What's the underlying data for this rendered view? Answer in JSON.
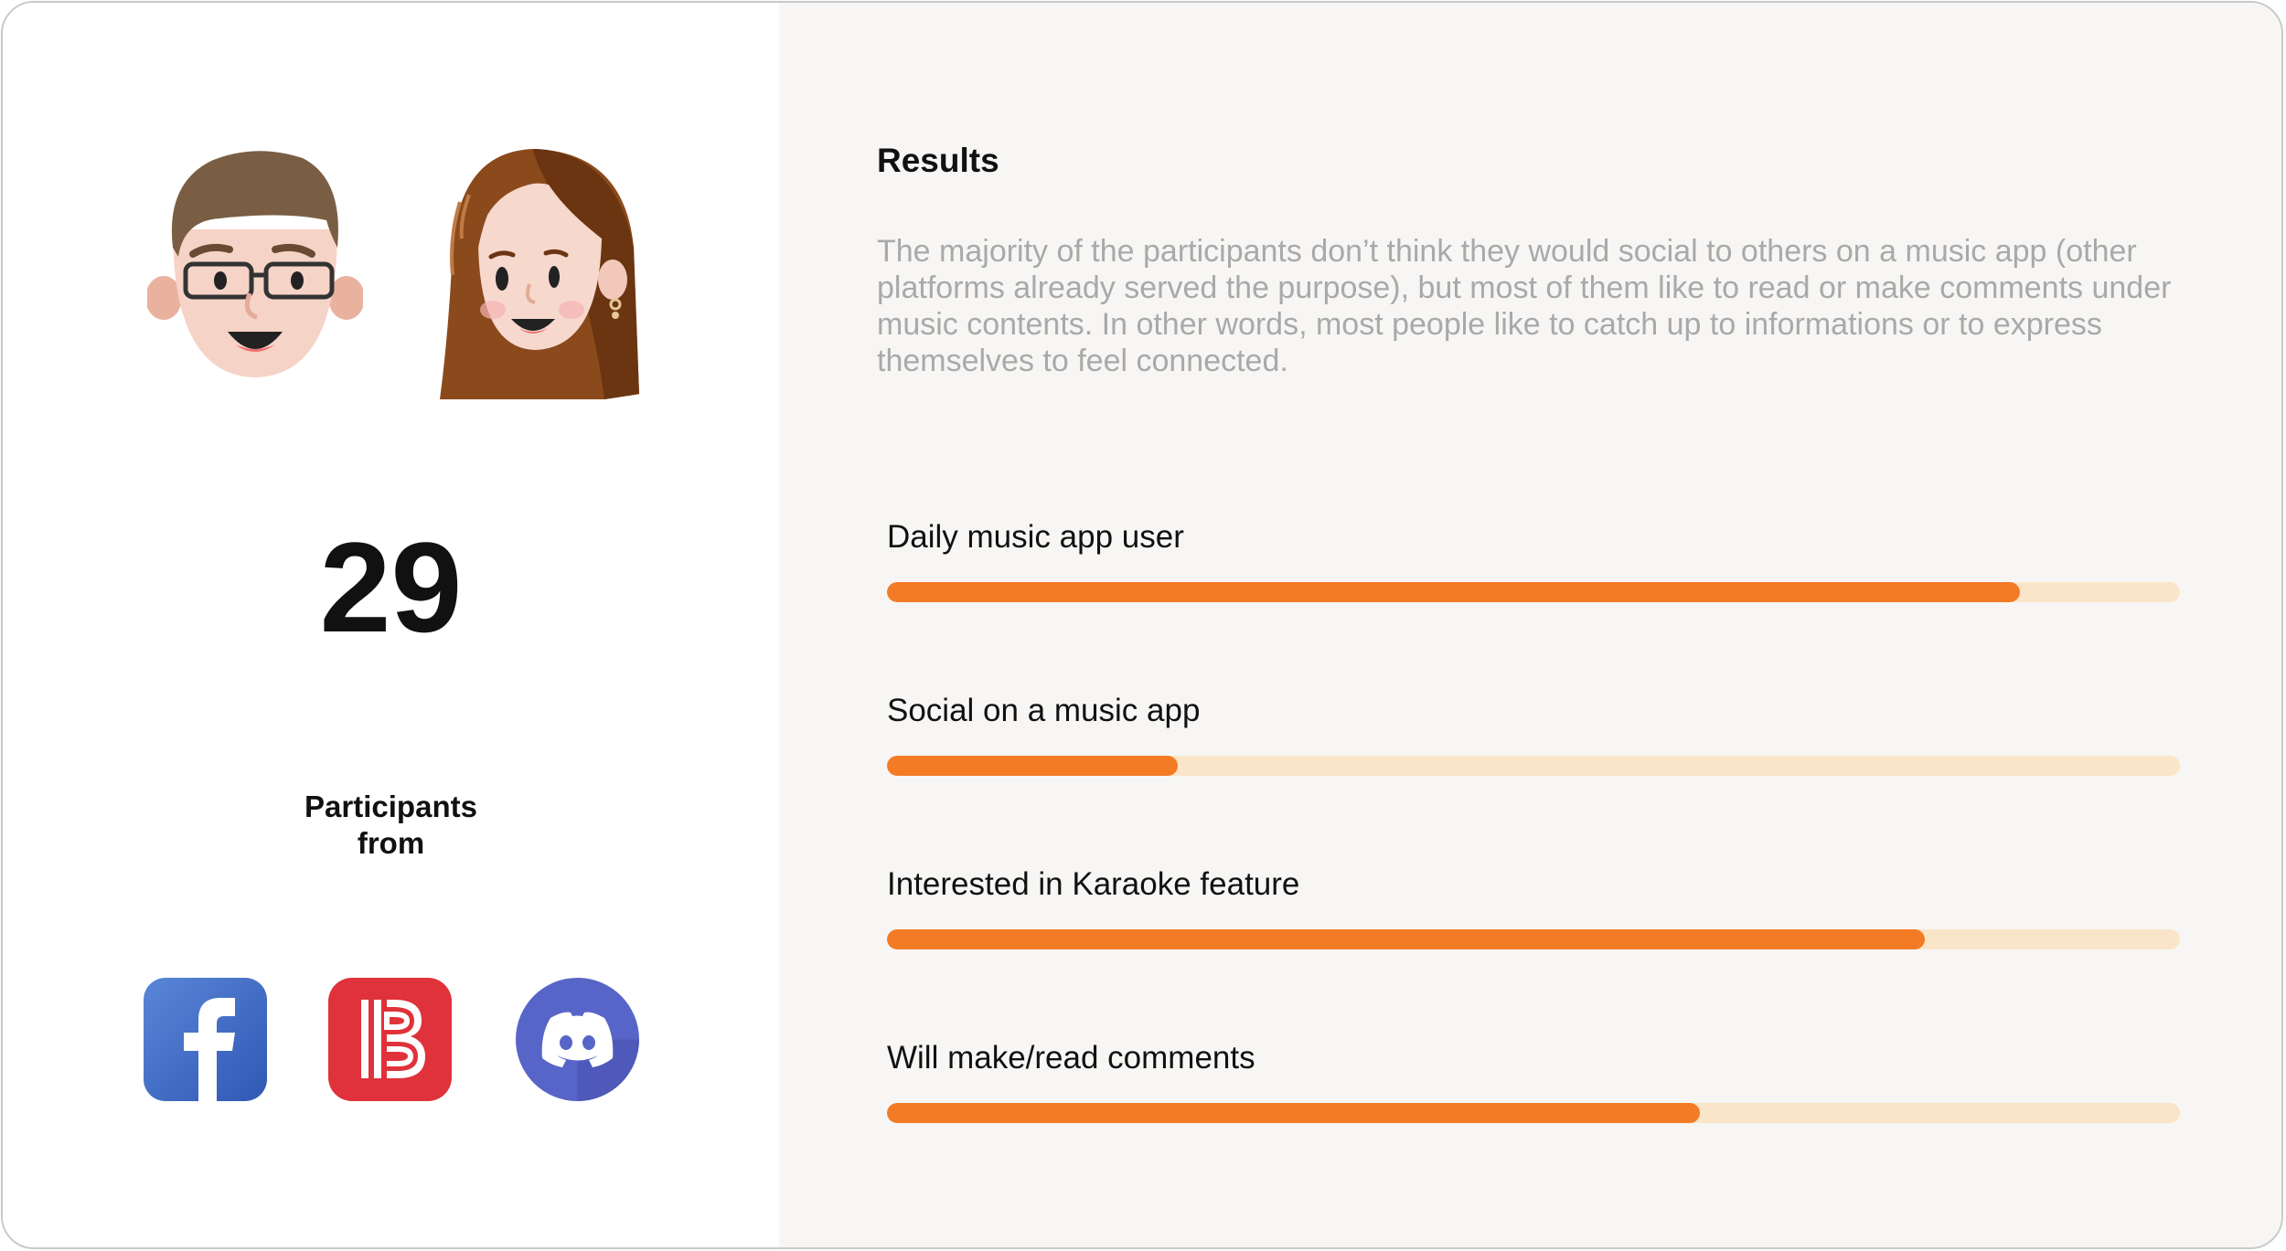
{
  "participants": {
    "count": "29",
    "label": "Participants from",
    "avatars": [
      "male-avatar-icon",
      "female-avatar-icon"
    ],
    "platforms": [
      {
        "name": "Facebook",
        "icon": "facebook-icon",
        "color": "#3b6bc9"
      },
      {
        "name": "Bilibili",
        "icon": "bilibili-icon",
        "color": "#e0323a"
      },
      {
        "name": "Discord",
        "icon": "discord-icon",
        "color": "#5865c8"
      }
    ]
  },
  "results": {
    "title": "Results",
    "description": "The majority of the participants don’t think they would social to others on a music app (other platforms already served the purpose), but most of them like to read or make comments under music contents. In other words, most people like to catch up to informations or to express themselves to feel connected."
  },
  "stats": [
    {
      "label": "Daily music app user",
      "fraction": 0.876
    },
    {
      "label": "Social on a music app",
      "fraction": 0.225
    },
    {
      "label": "Interested in Karaoke feature",
      "fraction": 0.803
    },
    {
      "label": "Will make/read comments",
      "fraction": 0.629
    }
  ],
  "colors": {
    "bar_fill": "#f47b25",
    "bar_track": "#fbe5c8",
    "panel_bg": "#f7f6f4",
    "description_text": "#a9a9a9"
  }
}
